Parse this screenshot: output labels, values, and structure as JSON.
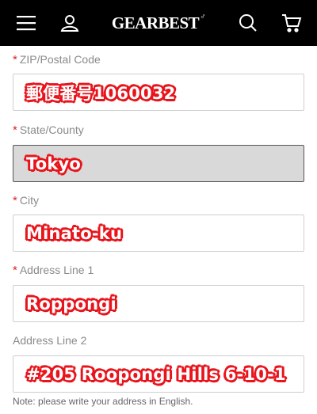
{
  "header": {
    "brand_text": "GEARBEST",
    "brand_mark": "♂",
    "icons": [
      "menu-icon",
      "user-icon",
      "search-icon",
      "cart-icon"
    ],
    "background": "#000000"
  },
  "form": {
    "required_marker": "*",
    "fields": [
      {
        "label": "ZIP/Postal Code",
        "required": true,
        "value": "郵便番号1060032"
      },
      {
        "label": "State/County",
        "required": true,
        "value": "Tokyo",
        "disabled": true
      },
      {
        "label": "City",
        "required": true,
        "value": "Minato-ku"
      },
      {
        "label": "Address Line 1",
        "required": true,
        "value": "Roppongi"
      },
      {
        "label": "Address Line 2",
        "required": false,
        "value": "#205 Roopongi Hills 6-10-1"
      }
    ],
    "note": "Note: please write your address in English."
  },
  "colors": {
    "required": "#e02020",
    "annotation": "#e8141c",
    "label": "#8a8a8a"
  }
}
